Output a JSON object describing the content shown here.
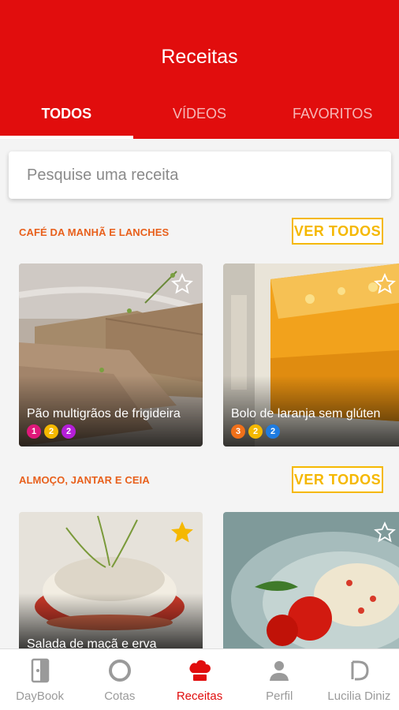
{
  "header": {
    "title": "Receitas",
    "tabs": [
      {
        "label": "TODOS",
        "active": true
      },
      {
        "label": "VÍDEOS",
        "active": false
      },
      {
        "label": "FAVORITOS",
        "active": false
      }
    ]
  },
  "search": {
    "placeholder": "Pesquise uma receita",
    "value": ""
  },
  "sections": [
    {
      "title": "CAFÉ DA MANHÃ E LANCHES",
      "see_all_label": "VER TODOS",
      "cards": [
        {
          "name": "Pão multigrãos de frigideira",
          "favorite": false,
          "badges": [
            {
              "value": "1",
              "color": "#e0187a"
            },
            {
              "value": "2",
              "color": "#f5b800"
            },
            {
              "value": "2",
              "color": "#b51ed8"
            }
          ]
        },
        {
          "name": "Bolo de laranja sem glúten",
          "favorite": false,
          "badges": [
            {
              "value": "3",
              "color": "#f0701a"
            },
            {
              "value": "2",
              "color": "#f5b800"
            },
            {
              "value": "2",
              "color": "#1e7be0"
            }
          ]
        }
      ]
    },
    {
      "title": "ALMOÇO, JANTAR E CEIA",
      "see_all_label": "VER TODOS",
      "cards": [
        {
          "name": "Salada de maçã e erva",
          "favorite": true
        },
        {
          "name": "",
          "favorite": false
        }
      ]
    }
  ],
  "bottom_nav": [
    {
      "label": "DayBook",
      "icon": "daybook-icon",
      "active": false
    },
    {
      "label": "Cotas",
      "icon": "circle-icon",
      "active": false
    },
    {
      "label": "Receitas",
      "icon": "chef-hat-icon",
      "active": true
    },
    {
      "label": "Perfil",
      "icon": "person-icon",
      "active": false
    },
    {
      "label": "Lucilia Diniz",
      "icon": "brand-d-icon",
      "active": false
    }
  ],
  "colors": {
    "primary": "#e10d0d",
    "section_title": "#e8601c",
    "see_all": "#f5b800",
    "inactive": "#9a9a9a"
  }
}
